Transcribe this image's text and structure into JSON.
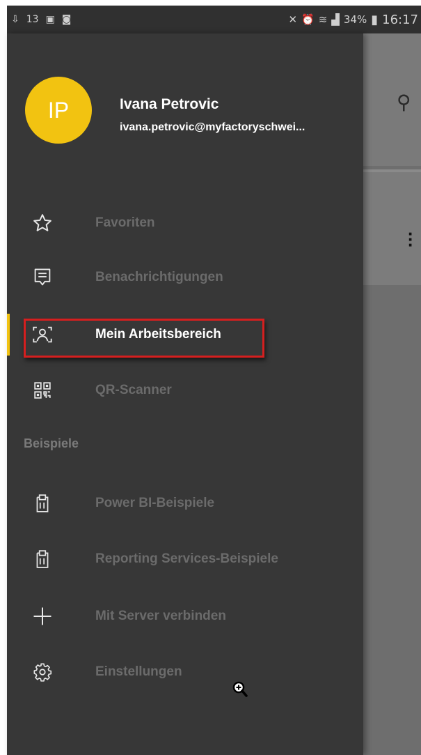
{
  "status_bar": {
    "left_icons": [
      "usb-icon",
      "notification-icon",
      "image-icon",
      "screenshot-icon"
    ],
    "left_text": "1̲3",
    "right_signal_text": "34%",
    "time": "16:17"
  },
  "drawer": {
    "user": {
      "initials": "IP",
      "name": "Ivana Petrovic",
      "email": "ivana.petrovic@myfactoryschwei..."
    },
    "items": [
      {
        "label": "Favoriten",
        "icon": "star-icon",
        "active": false
      },
      {
        "label": "Benachrichtigungen",
        "icon": "notifications-icon",
        "active": false
      },
      {
        "label": "Mein Arbeitsbereich",
        "icon": "workspace-icon",
        "active": true
      },
      {
        "label": "QR-Scanner",
        "icon": "qr-code-icon",
        "active": false
      }
    ],
    "section_label": "Beispiele",
    "section_items": [
      {
        "label": "Power BI-Beispiele",
        "icon": "clipboard-icon"
      },
      {
        "label": "Reporting Services-Beispiele",
        "icon": "clipboard-icon"
      },
      {
        "label": "Mit Server verbinden",
        "icon": "plus-icon"
      },
      {
        "label": "Einstellungen",
        "icon": "gear-icon"
      }
    ]
  },
  "colors": {
    "drawer_bg": "#373737",
    "accent": "#f2c311",
    "highlight_border": "#d51f1f",
    "inactive_text": "#6b6b6b"
  }
}
